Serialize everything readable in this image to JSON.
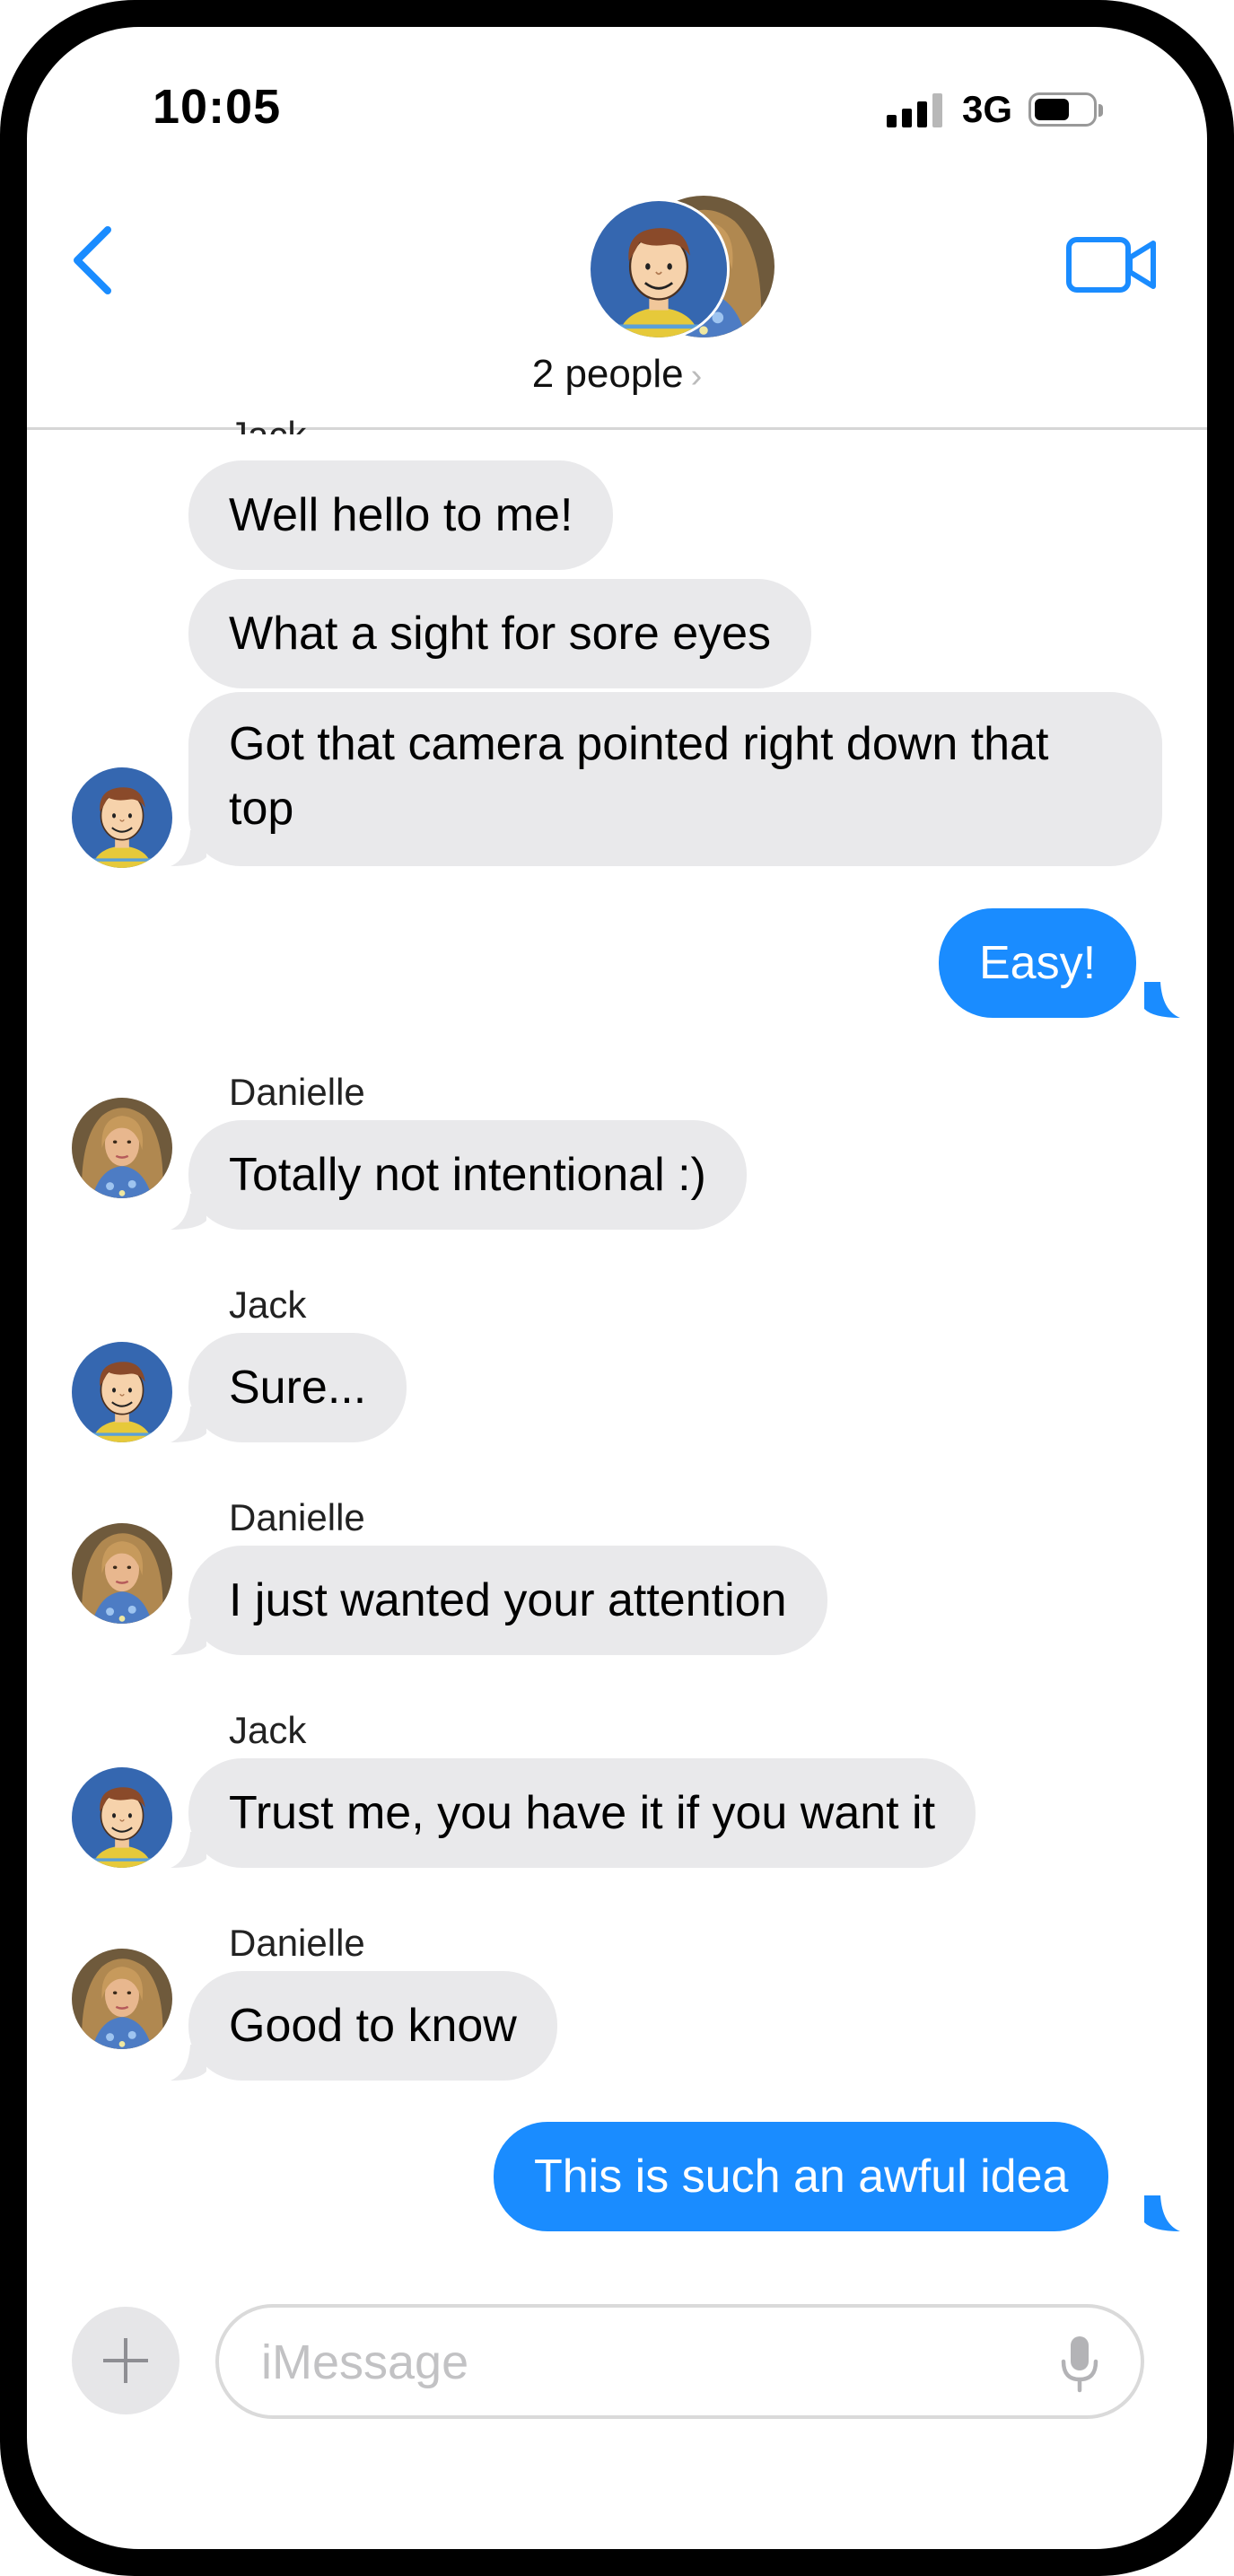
{
  "status_bar": {
    "time": "10:05",
    "network": "3G",
    "signal_bars": 4,
    "battery_level": 0.55
  },
  "header": {
    "title": "2 people",
    "back_icon": "chevron-left-icon",
    "video_icon": "video-camera-icon"
  },
  "colors": {
    "accent": "#1a8cff",
    "incoming_bubble": "#e9e9eb",
    "avatar_jack_bg": "#3567b0"
  },
  "messages": [
    {
      "sender": "Jack",
      "text": "Well hello to me!",
      "from_me": false
    },
    {
      "text": "What a sight for sore eyes",
      "from_me": false
    },
    {
      "text_line1": "Got that camera pointed right down that",
      "text_line2": "top",
      "from_me": false
    },
    {
      "text": "Easy!",
      "from_me": true
    },
    {
      "sender": "Danielle",
      "text": "Totally not intentional :)",
      "from_me": false
    },
    {
      "sender": "Jack",
      "text": "Sure...",
      "from_me": false
    },
    {
      "sender": "Danielle",
      "text": "I just wanted your attention",
      "from_me": false
    },
    {
      "sender": "Jack",
      "text": "Trust me, you have it if you want it",
      "from_me": false
    },
    {
      "sender": "Danielle",
      "text": "Good to know",
      "from_me": false
    },
    {
      "text": "This is such an awful idea",
      "from_me": true
    }
  ],
  "composer": {
    "placeholder": "iMessage",
    "value": "",
    "plus_icon": "plus-icon",
    "mic_icon": "microphone-icon"
  }
}
